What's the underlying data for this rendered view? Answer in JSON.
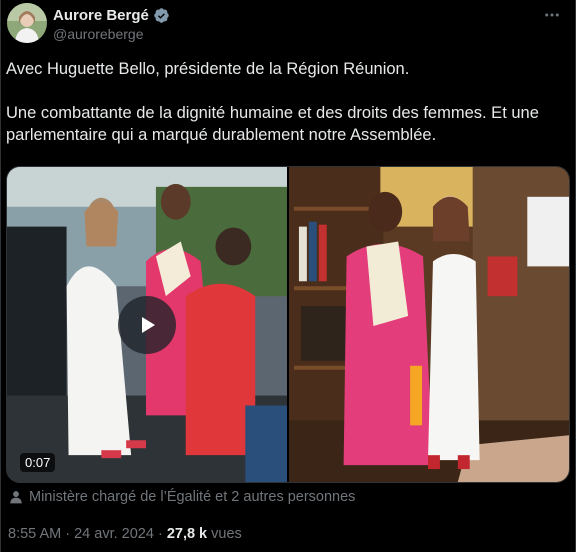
{
  "author": {
    "name": "Aurore Bergé",
    "handle": "@auroreberge",
    "verified": true,
    "avatar": "avatar"
  },
  "menu_icon": "more-horizontal-icon",
  "tweet": {
    "paragraph_1": "Avec Huguette Bello, présidente de la Région Réunion.",
    "paragraph_2": "Une combattante de la dignité humaine et des droits des femmes. Et une parlementaire qui a marqué durablement notre Assemblée."
  },
  "media": {
    "video_duration": "0:07",
    "play_icon": "play-icon"
  },
  "tagged": {
    "icon": "person-icon",
    "text": "Ministère chargé de l’Égalité et 2 autres personnes"
  },
  "meta": {
    "time": "8:55 AM",
    "separator": " · ",
    "date": "24 avr. 2024",
    "separator2": " · ",
    "views_count": "27,8 k",
    "views_label": " vues"
  },
  "colors": {
    "background": "#000000",
    "text": "#e7e9ea",
    "secondary": "#71767b",
    "verified": "#829aab"
  }
}
